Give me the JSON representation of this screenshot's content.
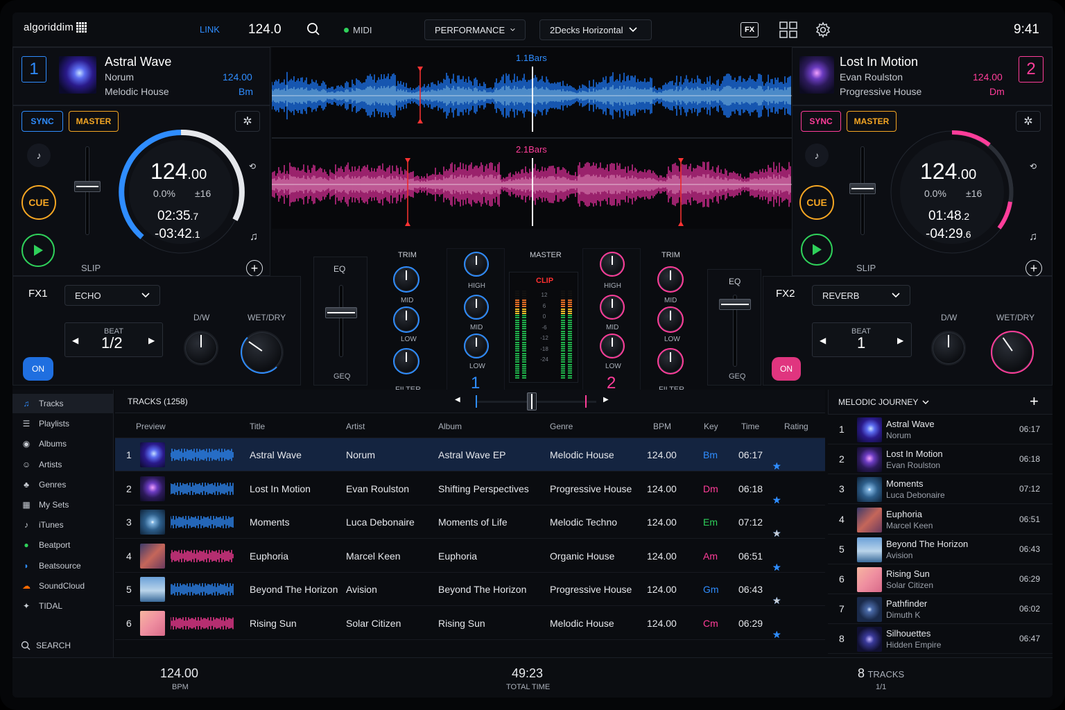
{
  "app": {
    "logo": "algoriddim",
    "clock": "9:41"
  },
  "topbar": {
    "link": "LINK",
    "bpm": "124.0",
    "midi": "MIDI",
    "mode": "PERFORMANCE",
    "layout": "2Decks Horizontal"
  },
  "deck1": {
    "num": "1",
    "title": "Astral Wave",
    "artist": "Norum",
    "genre": "Melodic House",
    "bpm": "124.00",
    "key": "Bm",
    "sync": "SYNC",
    "master": "MASTER",
    "cue": "CUE",
    "slip": "SLIP",
    "tempo_int": "124",
    "tempo_dec": ".00",
    "pitch": "0.0%",
    "range": "±16",
    "elapsed": "02:35",
    "elapsed_dec": ".7",
    "remain": "-03:42",
    "remain_dec": ".1",
    "progress": 0.42
  },
  "deck2": {
    "num": "2",
    "title": "Lost In Motion",
    "artist": "Evan Roulston",
    "genre": "Progressive House",
    "bpm": "124.00",
    "key": "Dm",
    "sync": "SYNC",
    "master": "MASTER",
    "cue": "CUE",
    "slip": "SLIP",
    "tempo_int": "124",
    "tempo_dec": ".00",
    "pitch": "0.0%",
    "range": "±16",
    "elapsed": "01:48",
    "elapsed_dec": ".2",
    "remain": "-04:29",
    "remain_dec": ".6",
    "progress": 0.29
  },
  "waveforms": {
    "top_label": "1.1Bars",
    "bottom_label": "2.1Bars"
  },
  "fx1": {
    "label": "FX1",
    "effect": "ECHO",
    "beat_label": "BEAT",
    "beat": "1/2",
    "dw": "D/W",
    "wetdry": "WET/DRY",
    "on": "ON"
  },
  "fx2": {
    "label": "FX2",
    "effect": "REVERB",
    "beat_label": "BEAT",
    "beat": "1",
    "dw": "D/W",
    "wetdry": "WET/DRY",
    "on": "ON"
  },
  "mixer": {
    "eq": "EQ",
    "geq": "GEQ",
    "trim": "TRIM",
    "mid": "MID",
    "low": "LOW",
    "high": "HIGH",
    "filter": "FILTER",
    "master": "MASTER",
    "clip": "CLIP",
    "ch1": "1",
    "ch2": "2",
    "scale": [
      "12",
      "6",
      "0",
      "-6",
      "-12",
      "-18",
      "-24"
    ]
  },
  "sidebar": {
    "items": [
      {
        "label": "Tracks",
        "icon": "music-note-icon"
      },
      {
        "label": "Playlists",
        "icon": "playlist-icon"
      },
      {
        "label": "Albums",
        "icon": "album-icon"
      },
      {
        "label": "Artists",
        "icon": "artist-icon"
      },
      {
        "label": "Genres",
        "icon": "genre-icon"
      },
      {
        "label": "My Sets",
        "icon": "sets-icon"
      },
      {
        "label": "iTunes",
        "icon": "itunes-icon"
      },
      {
        "label": "Beatport",
        "icon": "beatport-icon"
      },
      {
        "label": "Beatsource",
        "icon": "beatsource-icon"
      },
      {
        "label": "SoundCloud",
        "icon": "soundcloud-icon"
      },
      {
        "label": "TIDAL",
        "icon": "tidal-icon"
      }
    ],
    "search": "SEARCH"
  },
  "library": {
    "title": "TRACKS",
    "count": "(1258)",
    "columns": [
      "Preview",
      "Title",
      "Artist",
      "Album",
      "Genre",
      "BPM",
      "Key",
      "Time",
      "Rating"
    ],
    "rows": [
      {
        "n": "1",
        "title": "Astral Wave",
        "artist": "Norum",
        "album": "Astral Wave EP",
        "genre": "Melodic House",
        "bpm": "124.00",
        "key": "Bm",
        "time": "06:17",
        "rating": 5
      },
      {
        "n": "2",
        "title": "Lost In Motion",
        "artist": "Evan Roulston",
        "album": "Shifting Perspectives",
        "genre": "Progressive House",
        "bpm": "124.00",
        "key": "Dm",
        "time": "06:18",
        "rating": 5
      },
      {
        "n": "3",
        "title": "Moments",
        "artist": "Luca Debonaire",
        "album": "Moments of Life",
        "genre": "Melodic Techno",
        "bpm": "124.00",
        "key": "Em",
        "time": "07:12",
        "rating": 4
      },
      {
        "n": "4",
        "title": "Euphoria",
        "artist": "Marcel Keen",
        "album": "Euphoria",
        "genre": "Organic House",
        "bpm": "124.00",
        "key": "Am",
        "time": "06:51",
        "rating": 5
      },
      {
        "n": "5",
        "title": "Beyond The Horizon",
        "artist": "Avision",
        "album": "Beyond The Horizon",
        "genre": "Progressive House",
        "bpm": "124.00",
        "key": "Gm",
        "time": "06:43",
        "rating": 4
      },
      {
        "n": "6",
        "title": "Rising Sun",
        "artist": "Solar Citizen",
        "album": "Rising Sun",
        "genre": "Melodic House",
        "bpm": "124.00",
        "key": "Cm",
        "time": "06:29",
        "rating": 5
      }
    ]
  },
  "playlist": {
    "title": "MELODIC JOURNEY",
    "rows": [
      {
        "n": "1",
        "title": "Astral Wave",
        "artist": "Norum",
        "time": "06:17"
      },
      {
        "n": "2",
        "title": "Lost In Motion",
        "artist": "Evan Roulston",
        "time": "06:18"
      },
      {
        "n": "3",
        "title": "Moments",
        "artist": "Luca Debonaire",
        "time": "07:12"
      },
      {
        "n": "4",
        "title": "Euphoria",
        "artist": "Marcel Keen",
        "time": "06:51"
      },
      {
        "n": "5",
        "title": "Beyond The Horizon",
        "artist": "Avision",
        "time": "06:43"
      },
      {
        "n": "6",
        "title": "Rising Sun",
        "artist": "Solar Citizen",
        "time": "06:29"
      },
      {
        "n": "7",
        "title": "Pathfinder",
        "artist": "Dimuth K",
        "time": "06:02"
      },
      {
        "n": "8",
        "title": "Silhouettes",
        "artist": "Hidden Empire",
        "time": "06:47"
      }
    ]
  },
  "footer": {
    "bpm": "124.00",
    "bpm_label": "BPM",
    "total": "49:23",
    "total_label": "TOTAL TIME",
    "tracks": "8",
    "tracks_label": "TRACKS",
    "page": "1/1"
  },
  "colors": {
    "blue": "#2f8dff",
    "pink": "#ff3d9a",
    "orange": "#f5a623",
    "green": "#2fd05a"
  }
}
